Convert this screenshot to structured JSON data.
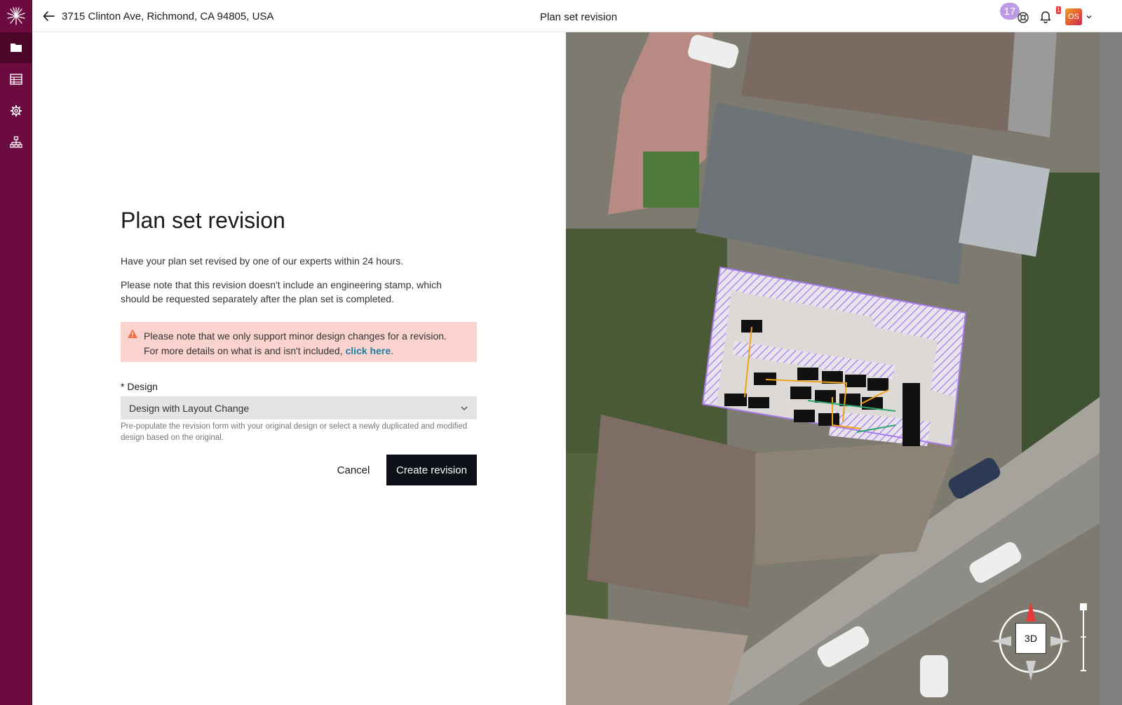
{
  "header": {
    "address": "3715 Clinton Ave, Richmond, CA 94805, USA",
    "title": "Plan set revision",
    "help_badge_count": "17",
    "notification_count": "1",
    "avatar_initials": "OS"
  },
  "sidebar": {
    "items": [
      {
        "icon": "folder-icon",
        "active": true
      },
      {
        "icon": "table-icon",
        "active": false
      },
      {
        "icon": "gear-icon",
        "active": false
      },
      {
        "icon": "org-chart-icon",
        "active": false
      }
    ]
  },
  "main": {
    "heading": "Plan set revision",
    "intro": "Have your plan set revised by one of our experts within 24 hours.",
    "note": "Please note that this revision doesn't include an engineering stamp, which should be requested separately after the plan set is completed.",
    "alert": {
      "line1": "Please note that we only support minor design changes for a revision.",
      "line2_prefix": "For more details on what is and isn't included, ",
      "link_text": "click here",
      "line2_suffix": ".",
      "color": "#fad3cf"
    },
    "design_label": "* Design",
    "design_value": "Design with Layout Change",
    "design_helper": "Pre-populate the revision form with your original design or select a newly duplicated and modified design based on the original.",
    "cancel_label": "Cancel",
    "create_label": "Create revision"
  },
  "map": {
    "view_toggle_label": "3D"
  },
  "colors": {
    "sidebar": "#6b0b3f",
    "primary_button": "#0d1117",
    "link": "#1e7fa6",
    "badge": "#b99ae3"
  }
}
